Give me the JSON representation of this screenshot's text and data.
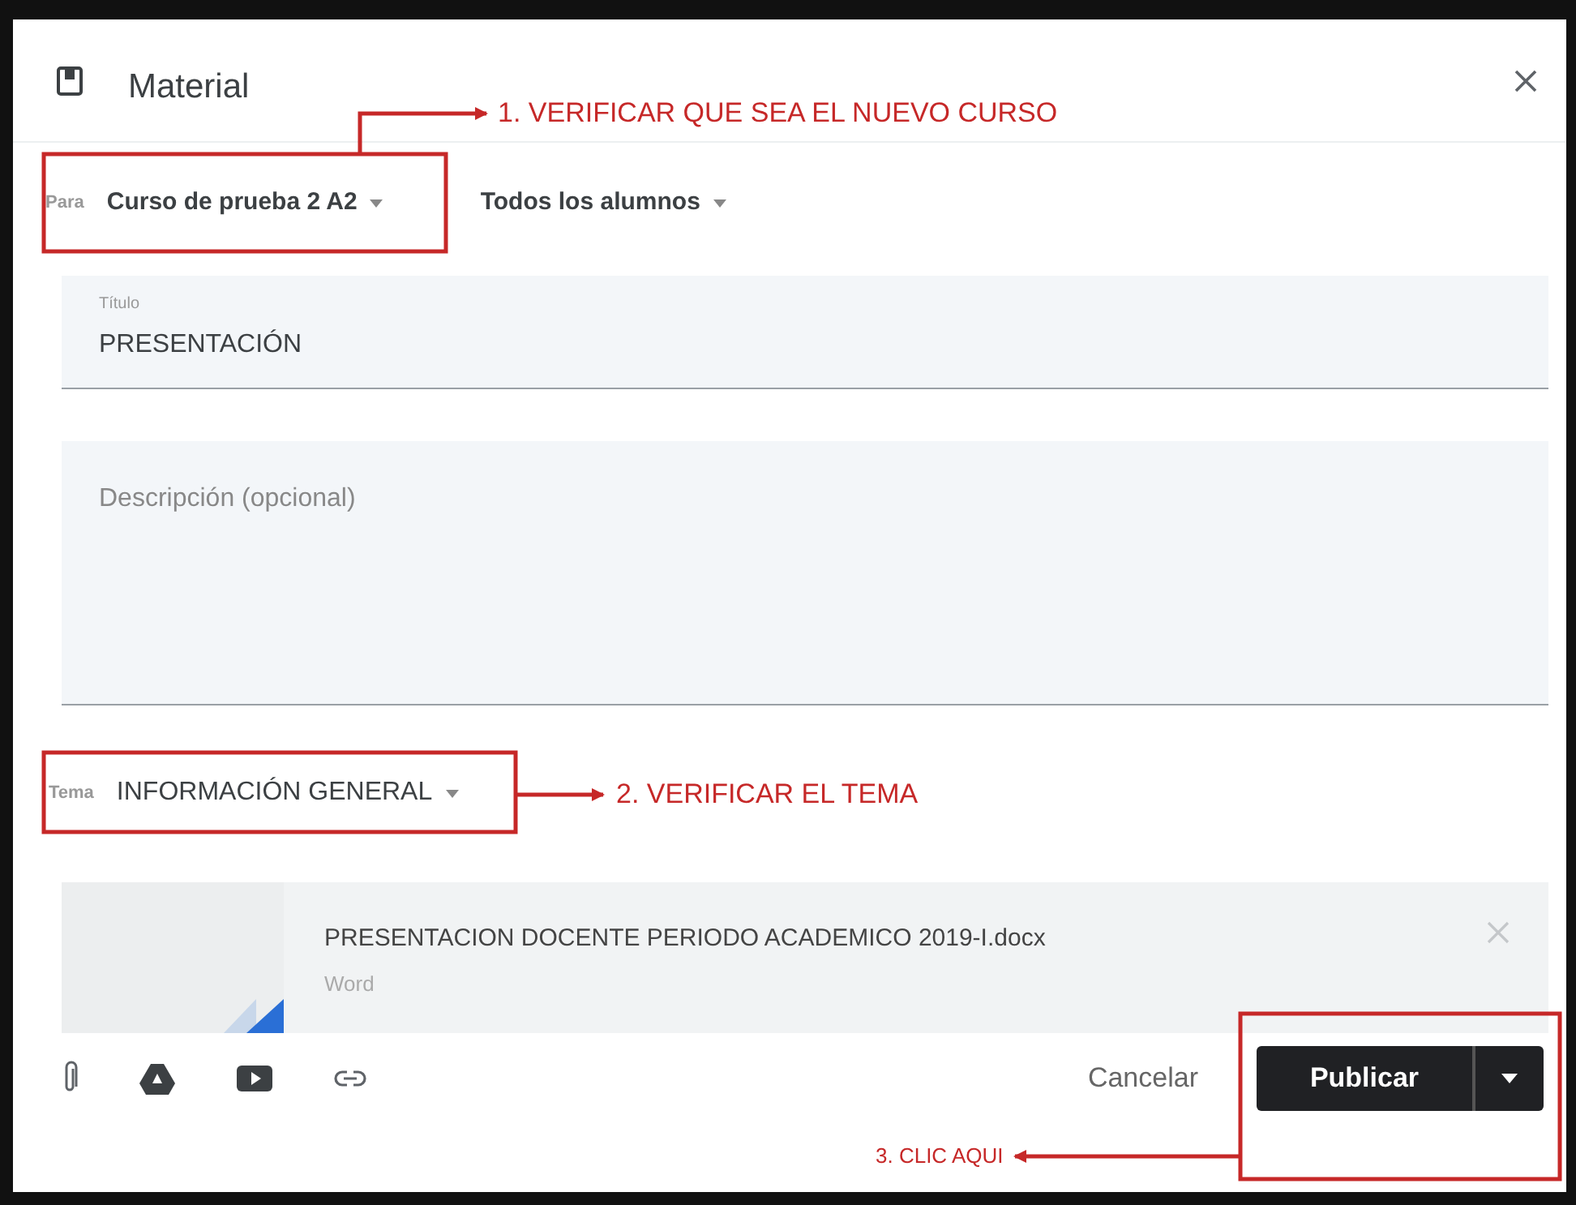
{
  "dialog": {
    "title": "Material"
  },
  "audience": {
    "label": "Para",
    "class": "Curso de prueba 2 A2",
    "students": "Todos los alumnos"
  },
  "title_field": {
    "label": "Título",
    "value": "PRESENTACIÓN"
  },
  "description_field": {
    "placeholder": "Descripción (opcional)"
  },
  "topic": {
    "label": "Tema",
    "value": "INFORMACIÓN GENERAL"
  },
  "attachment": {
    "name": "PRESENTACION DOCENTE PERIODO ACADEMICO 2019-I.docx",
    "type": "Word"
  },
  "buttons": {
    "cancel": "Cancelar",
    "publish": "Publicar"
  },
  "annotations": [
    {
      "text": "1. VERIFICAR QUE SEA EL NUEVO CURSO"
    },
    {
      "text": "2. VERIFICAR EL TEMA"
    },
    {
      "text": "3. CLIC AQUI"
    }
  ]
}
